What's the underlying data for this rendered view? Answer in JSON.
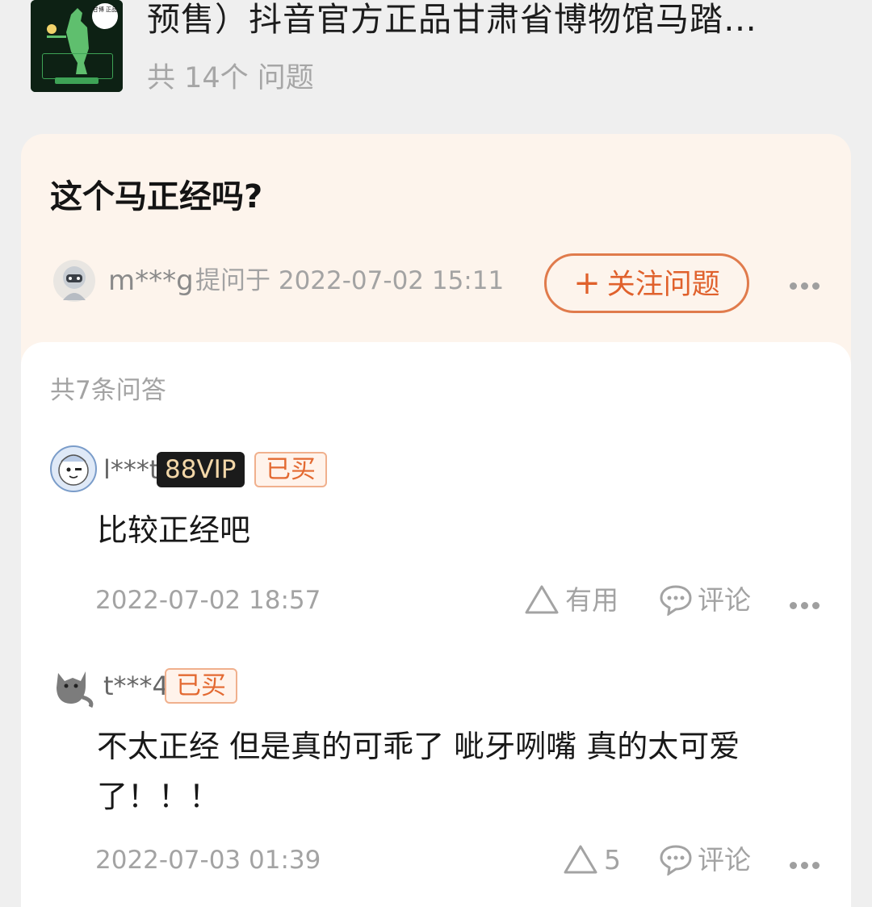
{
  "product": {
    "title": "预售）抖音官方正品甘肃省博物馆马踏…",
    "question_count": "共 14个 问题",
    "thumb_badge": "甘博 正品"
  },
  "question": {
    "text": "这个马正经吗?",
    "asker": "m***g",
    "asked_at": "提问于 2022-07-02 15:11",
    "follow_button": "关注问题",
    "follow_plus": "+"
  },
  "answers_panel": {
    "total": "共7条问答",
    "items": [
      {
        "user": "l***t",
        "vip_tag": "88VIP",
        "bought_tag": "已买",
        "text": "比较正经吧",
        "time": "2022-07-02 18:57",
        "useful_label": "有用",
        "comment_label": "评论"
      },
      {
        "user": "t***4",
        "bought_tag": "已买",
        "text": "不太正经 但是真的可乖了 呲牙咧嘴 真的太可爱了！！！",
        "time": "2022-07-03 01:39",
        "useful_count": "5",
        "comment_label": "评论"
      }
    ]
  },
  "colors": {
    "accent": "#e0612c",
    "question_card_bg": "#fdf4ec",
    "vip_tag_bg": "#1b1b1b",
    "bought_tag_bg": "#fff3eb"
  },
  "icons": [
    "thumbs-up-triangle-icon",
    "comment-bubble-icon",
    "more-dots-icon"
  ]
}
